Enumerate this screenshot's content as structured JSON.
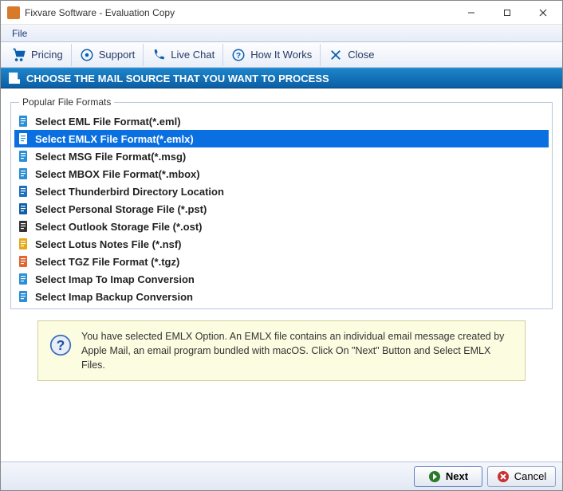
{
  "window": {
    "title": "Fixvare Software - Evaluation Copy"
  },
  "menubar": {
    "file": "File"
  },
  "toolbar": {
    "pricing": "Pricing",
    "support": "Support",
    "livechat": "Live Chat",
    "howitworks": "How It Works",
    "close": "Close"
  },
  "header": {
    "title": "CHOOSE THE MAIL SOURCE THAT YOU WANT TO PROCESS"
  },
  "formats": {
    "legend": "Popular File Formats",
    "items": [
      {
        "label": "Select EML File Format(*.eml)",
        "selected": false
      },
      {
        "label": "Select EMLX File Format(*.emlx)",
        "selected": true
      },
      {
        "label": "Select MSG File Format(*.msg)",
        "selected": false
      },
      {
        "label": "Select MBOX File Format(*.mbox)",
        "selected": false
      },
      {
        "label": "Select Thunderbird Directory Location",
        "selected": false
      },
      {
        "label": "Select Personal Storage File (*.pst)",
        "selected": false
      },
      {
        "label": "Select Outlook Storage File (*.ost)",
        "selected": false
      },
      {
        "label": "Select Lotus Notes File (*.nsf)",
        "selected": false
      },
      {
        "label": "Select TGZ File Format (*.tgz)",
        "selected": false
      },
      {
        "label": "Select Imap To Imap Conversion",
        "selected": false
      },
      {
        "label": "Select Imap Backup Conversion",
        "selected": false
      }
    ]
  },
  "info": {
    "text": "You have selected EMLX Option. An EMLX file contains an individual email message created by Apple Mail, an email program bundled with macOS. Click On \"Next\" Button and Select EMLX Files."
  },
  "footer": {
    "next": "Next",
    "cancel": "Cancel"
  }
}
